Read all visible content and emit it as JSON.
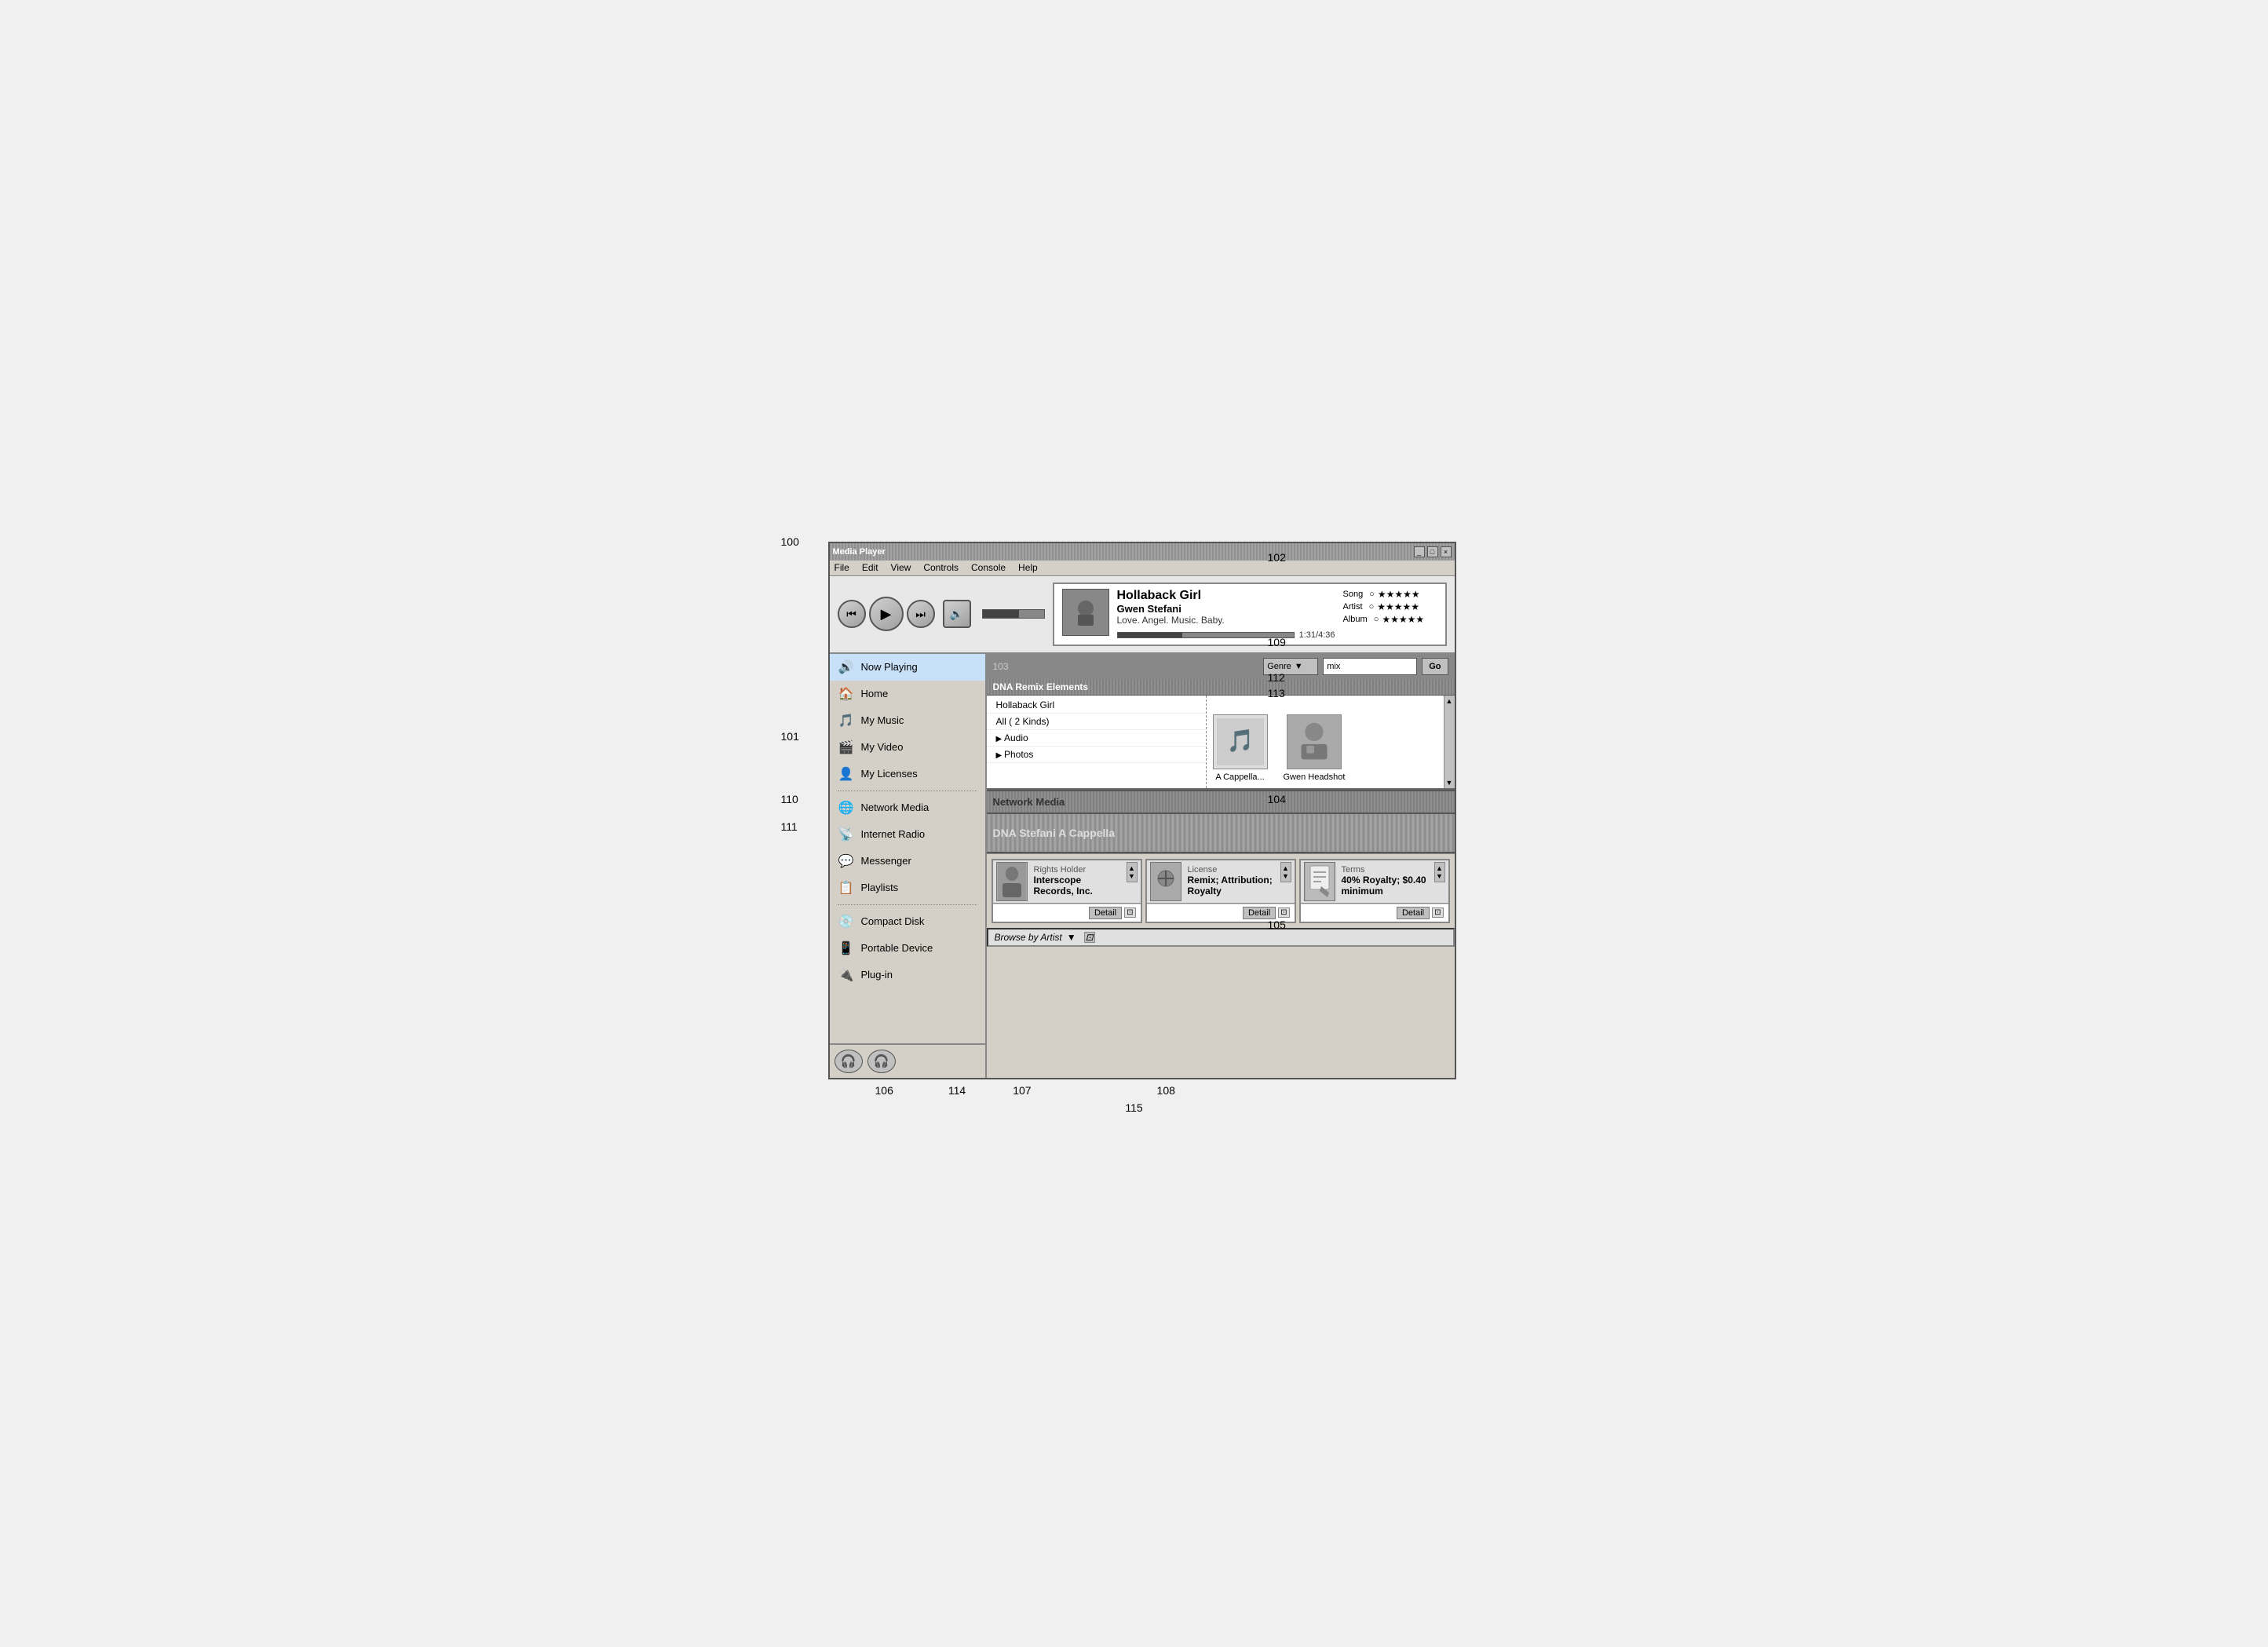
{
  "annotations": {
    "100": "100",
    "101": "101",
    "102": "102",
    "103": "103",
    "104": "104",
    "105": "105",
    "106": "106",
    "107": "107",
    "108": "108",
    "109": "109",
    "110": "110",
    "111": "111",
    "112": "112",
    "113": "113",
    "114": "114",
    "115": "115"
  },
  "menubar": {
    "items": [
      "File",
      "Edit",
      "View",
      "Controls",
      "Console",
      "Help"
    ]
  },
  "nowplaying": {
    "track_title": "Hollaback Girl",
    "artist": "Gwen Stefani",
    "album": "Love. Angel. Music. Baby.",
    "time": "1:31/4:36",
    "rating_song_label": "Song",
    "rating_artist_label": "Artist",
    "rating_album_label": "Album",
    "stars": "★★★★★"
  },
  "sidebar": {
    "items": [
      {
        "id": "now-playing",
        "icon": "🔊",
        "label": "Now Playing"
      },
      {
        "id": "home",
        "icon": "🏠",
        "label": "Home"
      },
      {
        "id": "my-music",
        "icon": "🎵",
        "label": "My Music"
      },
      {
        "id": "my-video",
        "icon": "🎬",
        "label": "My Video"
      },
      {
        "id": "my-licenses",
        "icon": "👤",
        "label": "My Licenses"
      },
      {
        "id": "network-media",
        "icon": "🌐",
        "label": "Network Media"
      },
      {
        "id": "internet-radio",
        "icon": "📡",
        "label": "Internet Radio"
      },
      {
        "id": "messenger",
        "icon": "💬",
        "label": "Messenger"
      },
      {
        "id": "playlists",
        "icon": "📋",
        "label": "Playlists"
      },
      {
        "id": "compact-disk",
        "icon": "💿",
        "label": "Compact Disk"
      },
      {
        "id": "portable-device",
        "icon": "📱",
        "label": "Portable Device"
      },
      {
        "id": "plug-in",
        "icon": "🔌",
        "label": "Plug-in"
      }
    ]
  },
  "filter": {
    "genre_label": "Genre",
    "search_placeholder": "mix",
    "go_label": "Go"
  },
  "panels": {
    "dna_remix": "DNA Remix Elements",
    "dna_artist": "DNA Stefani A Cappella",
    "network_media_label": "Network Media"
  },
  "file_browser": {
    "items": [
      {
        "label": "Hollaback Girl",
        "type": "file"
      },
      {
        "label": "All ( 2 Kinds)",
        "type": "file"
      },
      {
        "label": "Audio",
        "type": "folder"
      },
      {
        "label": "Photos",
        "type": "folder"
      }
    ]
  },
  "media_thumbs": [
    {
      "label": "A Cappella...",
      "icon": "🎵"
    },
    {
      "label": "Gwen Headshot",
      "icon": "📷"
    }
  ],
  "license_cards": [
    {
      "title": "Rights Holder",
      "value": "Interscope Records, Inc.",
      "icon": "👤",
      "detail_label": "Detail"
    },
    {
      "title": "License",
      "value": "Remix; Attribution; Royalty",
      "icon": "🔑",
      "detail_label": "Detail"
    },
    {
      "title": "Terms",
      "value": "40% Royalty; $0.40 minimum",
      "icon": "📄",
      "detail_label": "Detail"
    }
  ],
  "browse_bar": {
    "label": "Browse by Artist"
  },
  "titlebar": {
    "buttons": [
      "_",
      "□",
      "×"
    ]
  }
}
